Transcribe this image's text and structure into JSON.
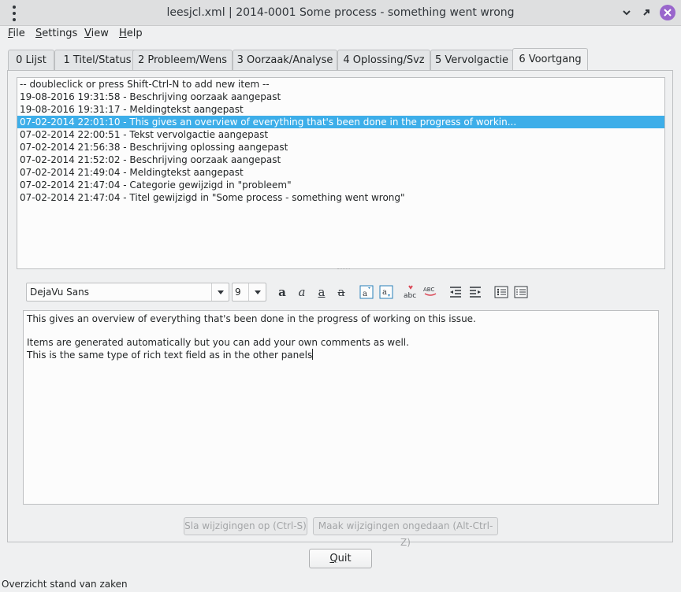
{
  "window": {
    "title": "leesjcl.xml | 2014-0001 Some process - something went wrong",
    "close_color": "#9966cc"
  },
  "menubar": {
    "items": [
      {
        "label": "File",
        "mnemonic": "F",
        "rest": "ile"
      },
      {
        "label": "Settings",
        "mnemonic": "S",
        "rest": "ettings"
      },
      {
        "label": "View",
        "mnemonic": "V",
        "rest": "iew"
      },
      {
        "label": "Help",
        "mnemonic": "H",
        "rest": "elp"
      }
    ]
  },
  "tabs": [
    {
      "label": "0 Lijst"
    },
    {
      "label": "1 Titel/Status"
    },
    {
      "label": "2 Probleem/Wens"
    },
    {
      "label": "3 Oorzaak/Analyse"
    },
    {
      "label": "4 Oplossing/Svz"
    },
    {
      "label": "5 Vervolgactie"
    },
    {
      "label": "6 Voortgang",
      "active": true
    }
  ],
  "progress_list": {
    "selection_color": "#3daee9",
    "items": [
      "-- doubleclick or press Shift-Ctrl-N to add new item --",
      "19-08-2016 19:31:58 - Beschrijving oorzaak aangepast",
      "19-08-2016 19:31:17 - Meldingtekst aangepast",
      "07-02-2014 22:01:10 - This gives an overview of everything that's been done in the progress  of workin...",
      "07-02-2014 22:00:51 - Tekst vervolgactie aangepast",
      "07-02-2014 21:56:38 - Beschrijving oplossing aangepast",
      "07-02-2014 21:52:02 - Beschrijving oorzaak aangepast",
      "07-02-2014 21:49:04 - Meldingtekst aangepast",
      "07-02-2014 21:47:04 - Categorie gewijzigd in \"probleem\"",
      "07-02-2014 21:47:04 - Titel gewijzigd in \"Some process - something went wrong\""
    ],
    "selected_index": 3
  },
  "toolbar": {
    "font_family": "DejaVu Sans",
    "font_size": "9",
    "icons": [
      "bold-icon",
      "italic-icon",
      "underline-icon",
      "strikethrough-icon",
      "superscript-icon",
      "subscript-icon",
      "spellcheck-icon",
      "uppercase-icon",
      "indent-less-icon",
      "indent-more-icon",
      "bullet-list-icon",
      "numbered-list-icon"
    ]
  },
  "editor": {
    "lines": [
      "This gives an overview of everything that's been done in the progress  of working on this issue.",
      "",
      "Items are generated automatically but you can add your own comments as well.",
      "This is the same type of rich text field as in the other panels"
    ]
  },
  "actions": {
    "save_label": "Sla wijzigingen op (Ctrl-S)",
    "undo_label": "Maak wijzigingen ongedaan (Alt-Ctrl-Z)"
  },
  "quit": {
    "mnemonic": "Q",
    "rest": "uit"
  },
  "status": {
    "text": "Overzicht stand van zaken"
  }
}
